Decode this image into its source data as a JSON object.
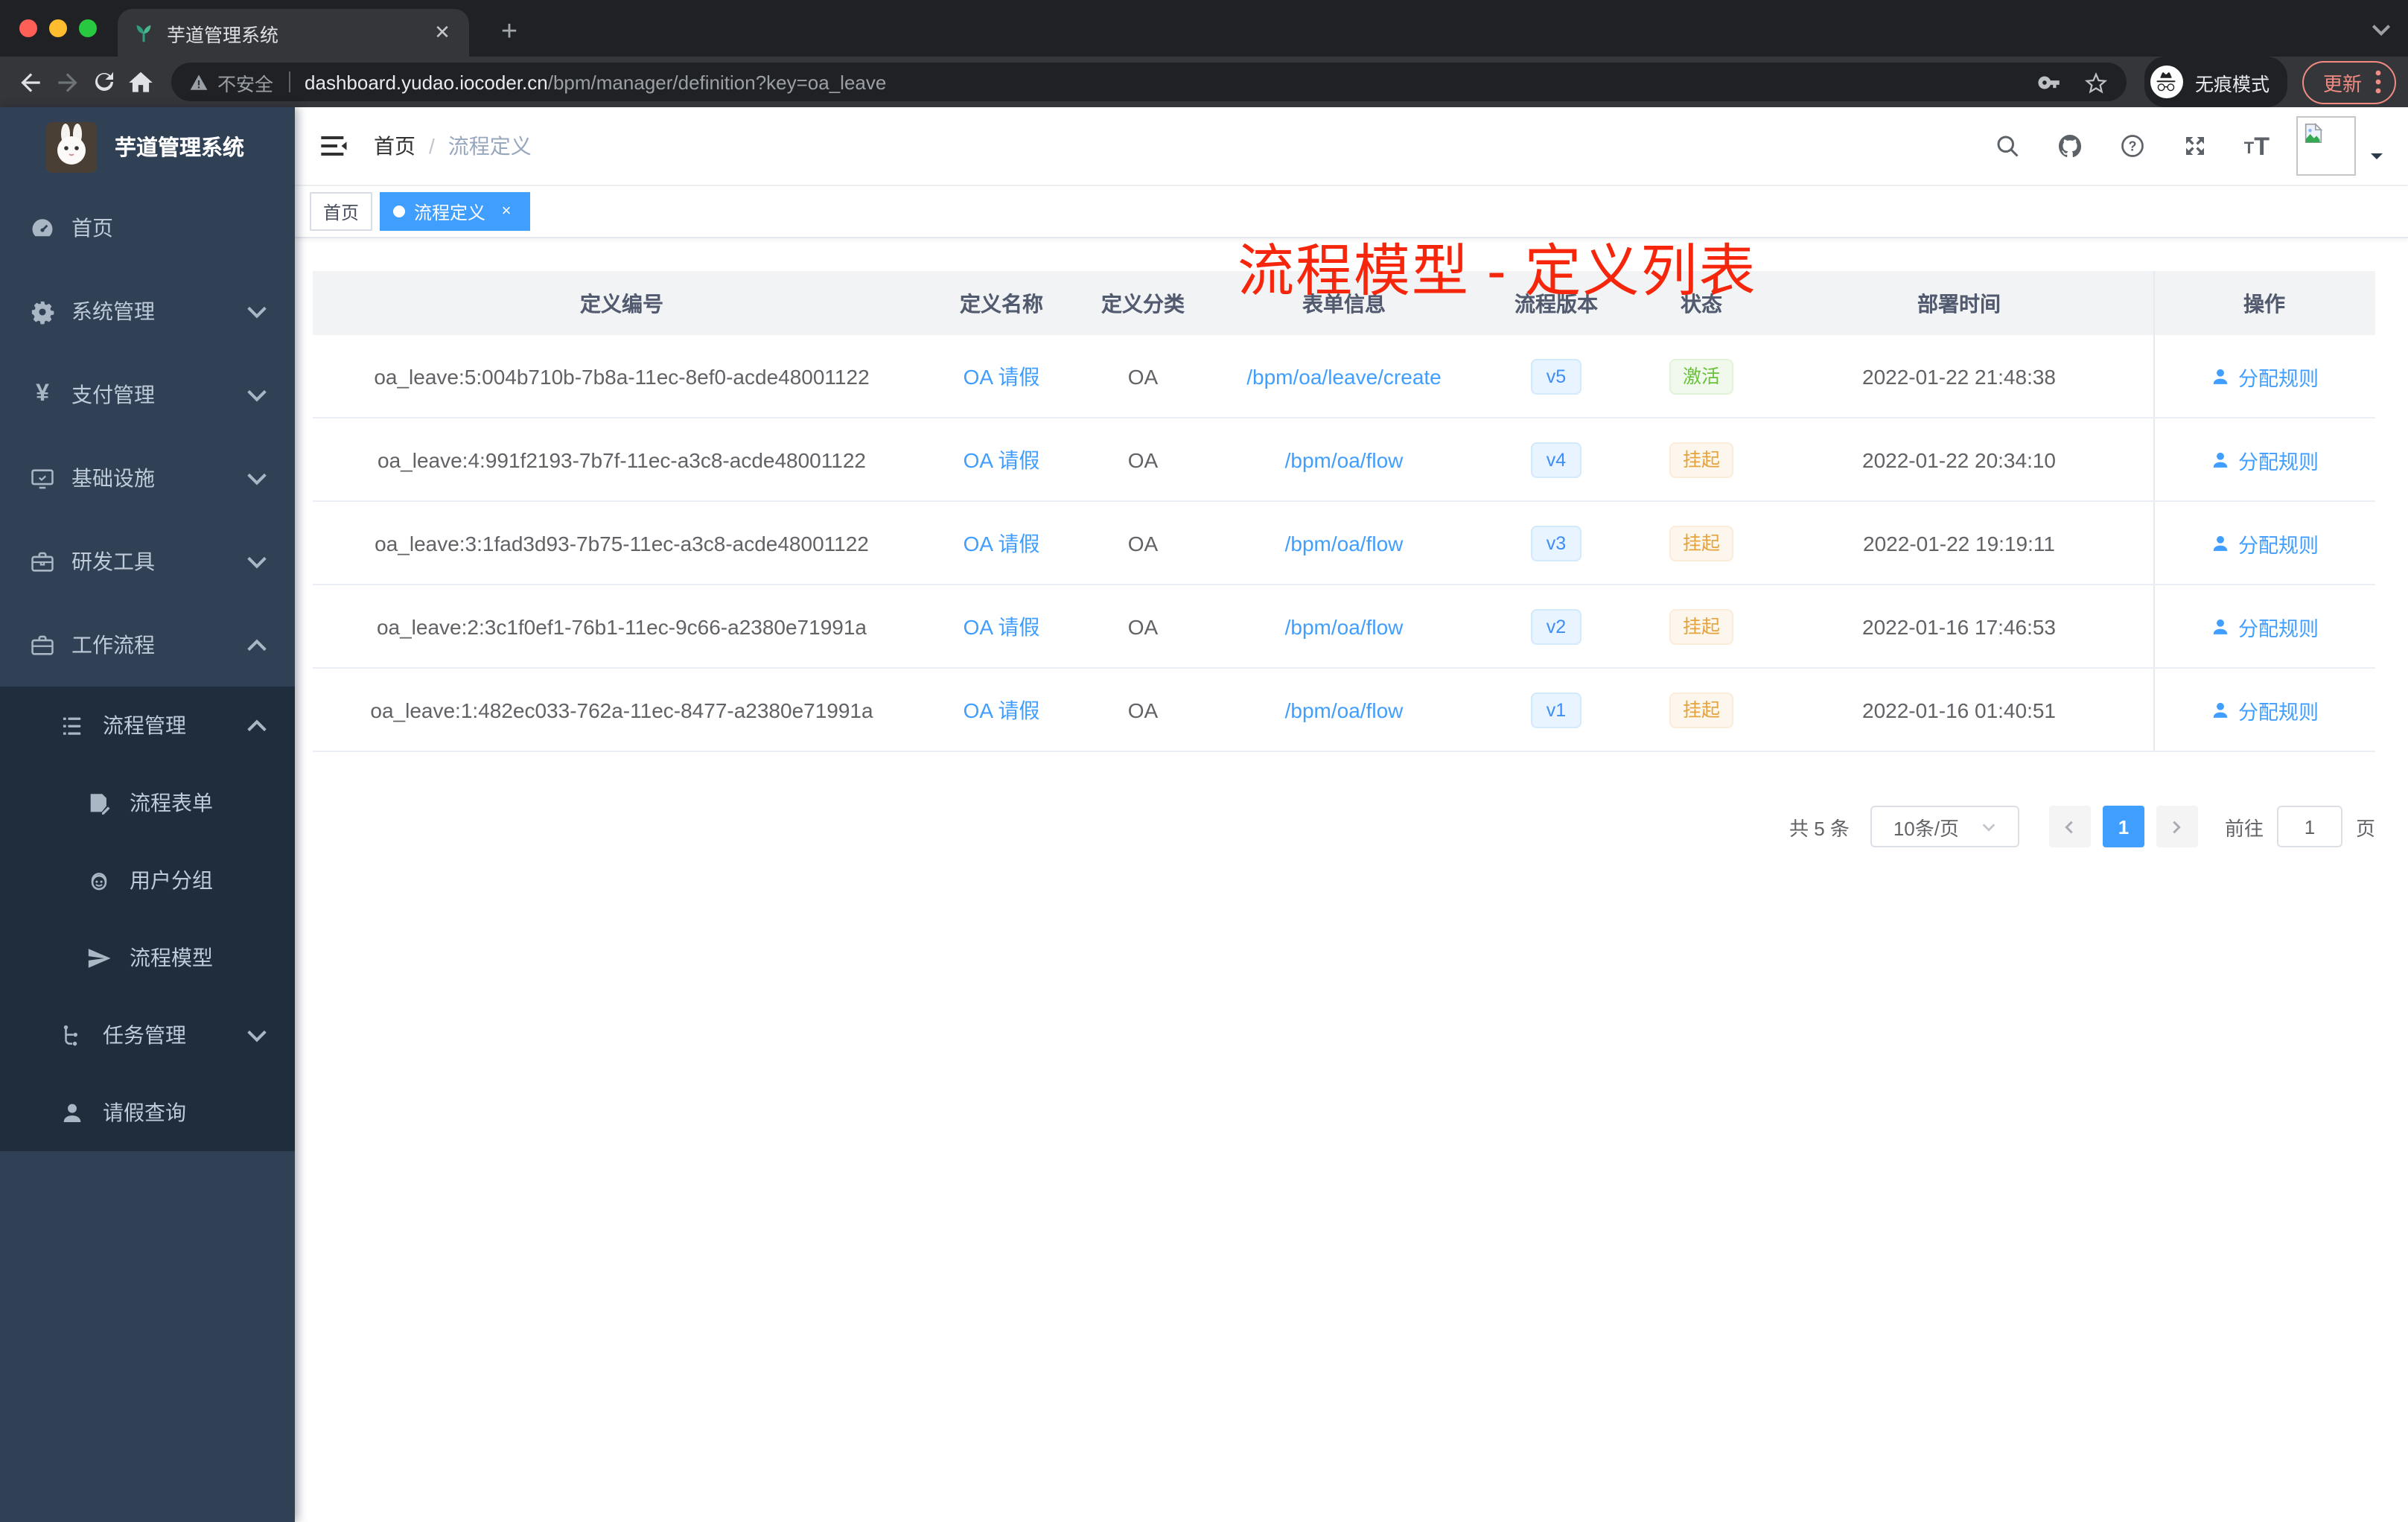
{
  "browser": {
    "tab_title": "芋道管理系统",
    "url_security": "不安全",
    "url_host": "dashboard.yudao.iocoder.cn",
    "url_path": "/bpm/manager/definition?key=oa_leave",
    "incognito_label": "无痕模式",
    "update_label": "更新"
  },
  "sidebar": {
    "logo_title": "芋道管理系统",
    "items": [
      {
        "key": "home",
        "icon": "dashboard-icon",
        "label": "首页",
        "level": 1,
        "chevron": "",
        "dark": false
      },
      {
        "key": "system-management",
        "icon": "gear-icon",
        "label": "系统管理",
        "level": 1,
        "chevron": "down",
        "dark": false
      },
      {
        "key": "payment-management",
        "icon": "yen-icon",
        "label": "支付管理",
        "level": 1,
        "chevron": "down",
        "dark": false
      },
      {
        "key": "infrastructure",
        "icon": "monitor-icon",
        "label": "基础设施",
        "level": 1,
        "chevron": "down",
        "dark": false
      },
      {
        "key": "dev-tools",
        "icon": "toolbox-icon",
        "label": "研发工具",
        "level": 1,
        "chevron": "down",
        "dark": false
      },
      {
        "key": "workflow",
        "icon": "briefcase-icon",
        "label": "工作流程",
        "level": 1,
        "chevron": "up",
        "dark": false
      },
      {
        "key": "process-management",
        "icon": "list-tree-icon",
        "label": "流程管理",
        "level": 2,
        "chevron": "up",
        "dark": true
      },
      {
        "key": "process-form",
        "icon": "form-doc-icon",
        "label": "流程表单",
        "level": 3,
        "chevron": "",
        "dark": true
      },
      {
        "key": "user-group",
        "icon": "robot-icon",
        "label": "用户分组",
        "level": 3,
        "chevron": "",
        "dark": true
      },
      {
        "key": "process-model",
        "icon": "paper-plane-icon",
        "label": "流程模型",
        "level": 3,
        "chevron": "",
        "dark": true
      },
      {
        "key": "task-management",
        "icon": "tree-icon",
        "label": "任务管理",
        "level": 2,
        "chevron": "down",
        "dark": true
      },
      {
        "key": "leave-query",
        "icon": "user-icon",
        "label": "请假查询",
        "level": 2,
        "chevron": "",
        "dark": true
      }
    ]
  },
  "navbar": {
    "breadcrumb": [
      "首页",
      "流程定义"
    ],
    "annotation": "流程模型 - 定义列表",
    "annotation_color": "#f5260b"
  },
  "tags_view": {
    "tags": [
      {
        "label": "首页",
        "active": false,
        "closable": false
      },
      {
        "label": "流程定义",
        "active": true,
        "closable": true
      }
    ]
  },
  "table": {
    "headers": [
      "定义编号",
      "定义名称",
      "定义分类",
      "表单信息",
      "流程版本",
      "状态",
      "部署时间",
      "操作"
    ],
    "rows": [
      {
        "id": "oa_leave:5:004b710b-7b8a-11ec-8ef0-acde48001122",
        "name": "OA 请假",
        "category": "OA",
        "form": "/bpm/oa/leave/create",
        "version": "v5",
        "status": "激活",
        "status_type": "success",
        "time": "2022-01-22 21:48:38",
        "action": "分配规则"
      },
      {
        "id": "oa_leave:4:991f2193-7b7f-11ec-a3c8-acde48001122",
        "name": "OA 请假",
        "category": "OA",
        "form": "/bpm/oa/flow",
        "version": "v4",
        "status": "挂起",
        "status_type": "warning",
        "time": "2022-01-22 20:34:10",
        "action": "分配规则"
      },
      {
        "id": "oa_leave:3:1fad3d93-7b75-11ec-a3c8-acde48001122",
        "name": "OA 请假",
        "category": "OA",
        "form": "/bpm/oa/flow",
        "version": "v3",
        "status": "挂起",
        "status_type": "warning",
        "time": "2022-01-22 19:19:11",
        "action": "分配规则"
      },
      {
        "id": "oa_leave:2:3c1f0ef1-76b1-11ec-9c66-a2380e71991a",
        "name": "OA 请假",
        "category": "OA",
        "form": "/bpm/oa/flow",
        "version": "v2",
        "status": "挂起",
        "status_type": "warning",
        "time": "2022-01-16 17:46:53",
        "action": "分配规则"
      },
      {
        "id": "oa_leave:1:482ec033-762a-11ec-8477-a2380e71991a",
        "name": "OA 请假",
        "category": "OA",
        "form": "/bpm/oa/flow",
        "version": "v1",
        "status": "挂起",
        "status_type": "warning",
        "time": "2022-01-16 01:40:51",
        "action": "分配规则"
      }
    ]
  },
  "pagination": {
    "total_label": "共 5 条",
    "page_size": "10条/页",
    "current_page": "1",
    "goto_label": "前往",
    "goto_value": "1",
    "page_unit": "页"
  },
  "colors": {
    "accent": "#409eff",
    "sidebar_bg": "#304156",
    "submenu_bg": "#1f2d3d",
    "tag_success": "#67c23a",
    "tag_warning": "#e6a23c",
    "version_tag": "#3e8ef7"
  }
}
